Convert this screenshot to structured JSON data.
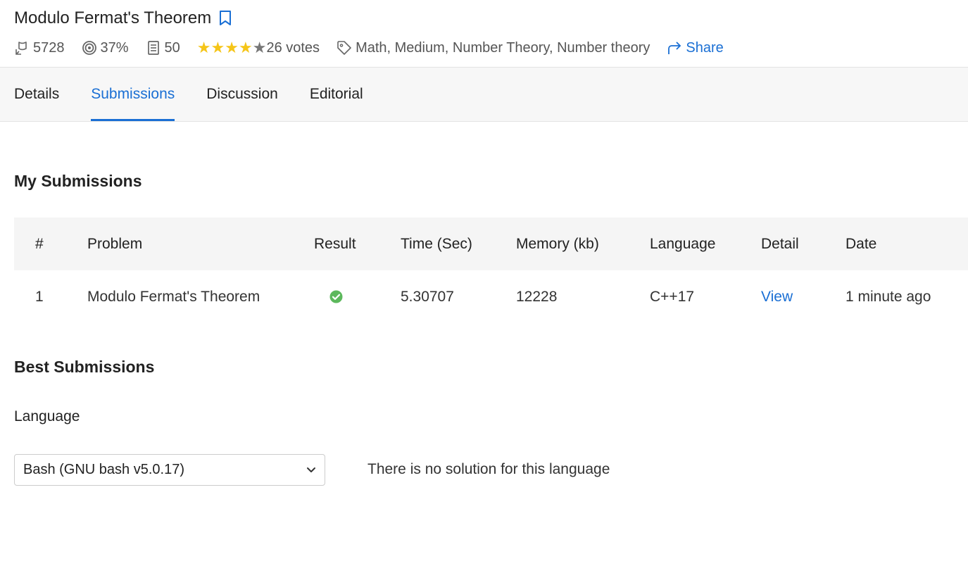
{
  "problem": {
    "title": "Modulo Fermat's Theorem",
    "solved_count": "5728",
    "success_rate": "37%",
    "submissions_count": "50",
    "rating": 4,
    "rating_max": 5,
    "votes": "26 votes",
    "tags": "Math, Medium, Number Theory, Number theory",
    "share_label": "Share"
  },
  "tabs": [
    {
      "label": "Details",
      "active": false
    },
    {
      "label": "Submissions",
      "active": true
    },
    {
      "label": "Discussion",
      "active": false
    },
    {
      "label": "Editorial",
      "active": false
    }
  ],
  "my_submissions": {
    "heading": "My Submissions",
    "columns": [
      "#",
      "Problem",
      "Result",
      "Time (Sec)",
      "Memory (kb)",
      "Language",
      "Detail",
      "Date"
    ],
    "rows": [
      {
        "index": "1",
        "problem": "Modulo Fermat's Theorem",
        "result_icon": "check-circle-icon",
        "time": "5.30707",
        "memory": "12228",
        "language": "C++17",
        "detail": "View",
        "date": "1 minute ago"
      }
    ]
  },
  "best_submissions": {
    "heading": "Best Submissions",
    "language_label": "Language",
    "selected_language": "Bash (GNU bash v5.0.17)",
    "empty_message": "There is no solution for this language"
  },
  "colors": {
    "accent": "#1a6fd4",
    "star": "#f5c518",
    "success": "#5cb85c"
  }
}
